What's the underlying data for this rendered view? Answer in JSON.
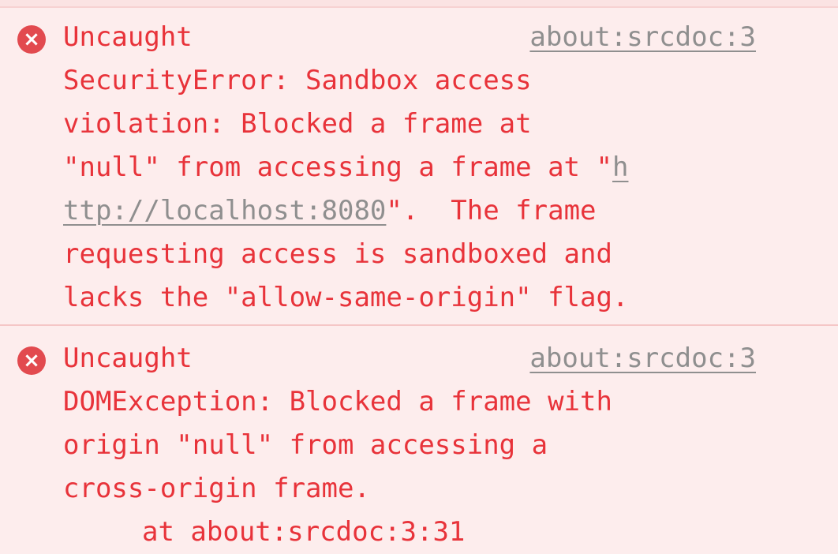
{
  "messages": [
    {
      "source": "about:srcdoc:3",
      "line1": "Uncaught",
      "line2": "SecurityError: Sandbox access",
      "line3": "violation: Blocked a frame at",
      "line4_text": "\"null\" from accessing a frame at \"",
      "line4_url": "h",
      "line5_url": "ttp://localhost:8080",
      "line5_text": "\".  The frame",
      "line6": "requesting access is sandboxed and",
      "line7": "lacks the \"allow-same-origin\" flag."
    },
    {
      "source": "about:srcdoc:3",
      "line1": "Uncaught",
      "line2": "DOMException: Blocked a frame with",
      "line3": "origin \"null\" from accessing a",
      "line4": "cross-origin frame.",
      "stack": "at about:srcdoc:3:31"
    }
  ],
  "icons": {
    "error": "error-circle-icon",
    "error_glyph": "×"
  },
  "colors": {
    "error_text": "#e8333a",
    "background": "#fdeded",
    "link": "#8f8f8f",
    "icon": "#e24a4f"
  }
}
